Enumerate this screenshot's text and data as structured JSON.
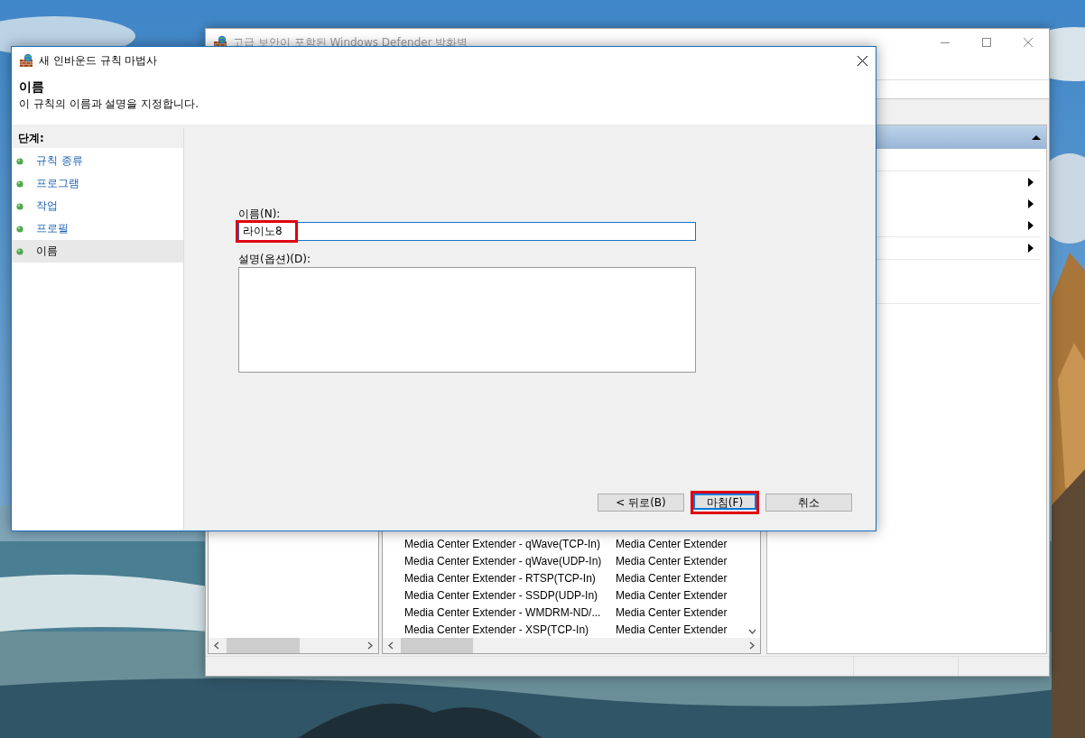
{
  "back_window": {
    "title": "고급 보안이 포함된 Windows Defender 방화벽",
    "active": false,
    "actions_pane": {
      "expanded": true
    },
    "rule_list": {
      "rows": [
        {
          "name": "Media Center Extender - qWave(TCP-In)",
          "group": "Media Center Extender"
        },
        {
          "name": "Media Center Extender - qWave(UDP-In)",
          "group": "Media Center Extender"
        },
        {
          "name": "Media Center Extender - RTSP(TCP-In)",
          "group": "Media Center Extender"
        },
        {
          "name": "Media Center Extender - SSDP(UDP-In)",
          "group": "Media Center Extender"
        },
        {
          "name": "Media Center Extender - WMDRM-ND/...",
          "group": "Media Center Extender"
        },
        {
          "name": "Media Center Extender - XSP(TCP-In)",
          "group": "Media Center Extender"
        }
      ]
    }
  },
  "wizard": {
    "title": "새 인바운드 규칙 마법사",
    "active": true,
    "heading": "이름",
    "description": "이 규칙의 이름과 설명을 지정합니다.",
    "steps_title": "단계:",
    "steps": [
      {
        "label": "규칙 종류",
        "selected": false
      },
      {
        "label": "프로그램",
        "selected": false
      },
      {
        "label": "작업",
        "selected": false
      },
      {
        "label": "프로필",
        "selected": false
      },
      {
        "label": "이름",
        "selected": true
      }
    ],
    "name_field": {
      "label": "이름(N):",
      "value": "라이노8",
      "highlighted": true
    },
    "description_field": {
      "label": "설명(옵션)(D):"
    },
    "buttons": [
      {
        "label": "< 뒤로(B)",
        "kind": "back",
        "default": false,
        "highlighted": false
      },
      {
        "label": "마침(F)",
        "kind": "finish",
        "default": true,
        "highlighted": true
      },
      {
        "label": "취소",
        "kind": "cancel",
        "default": false,
        "highlighted": false
      }
    ]
  }
}
